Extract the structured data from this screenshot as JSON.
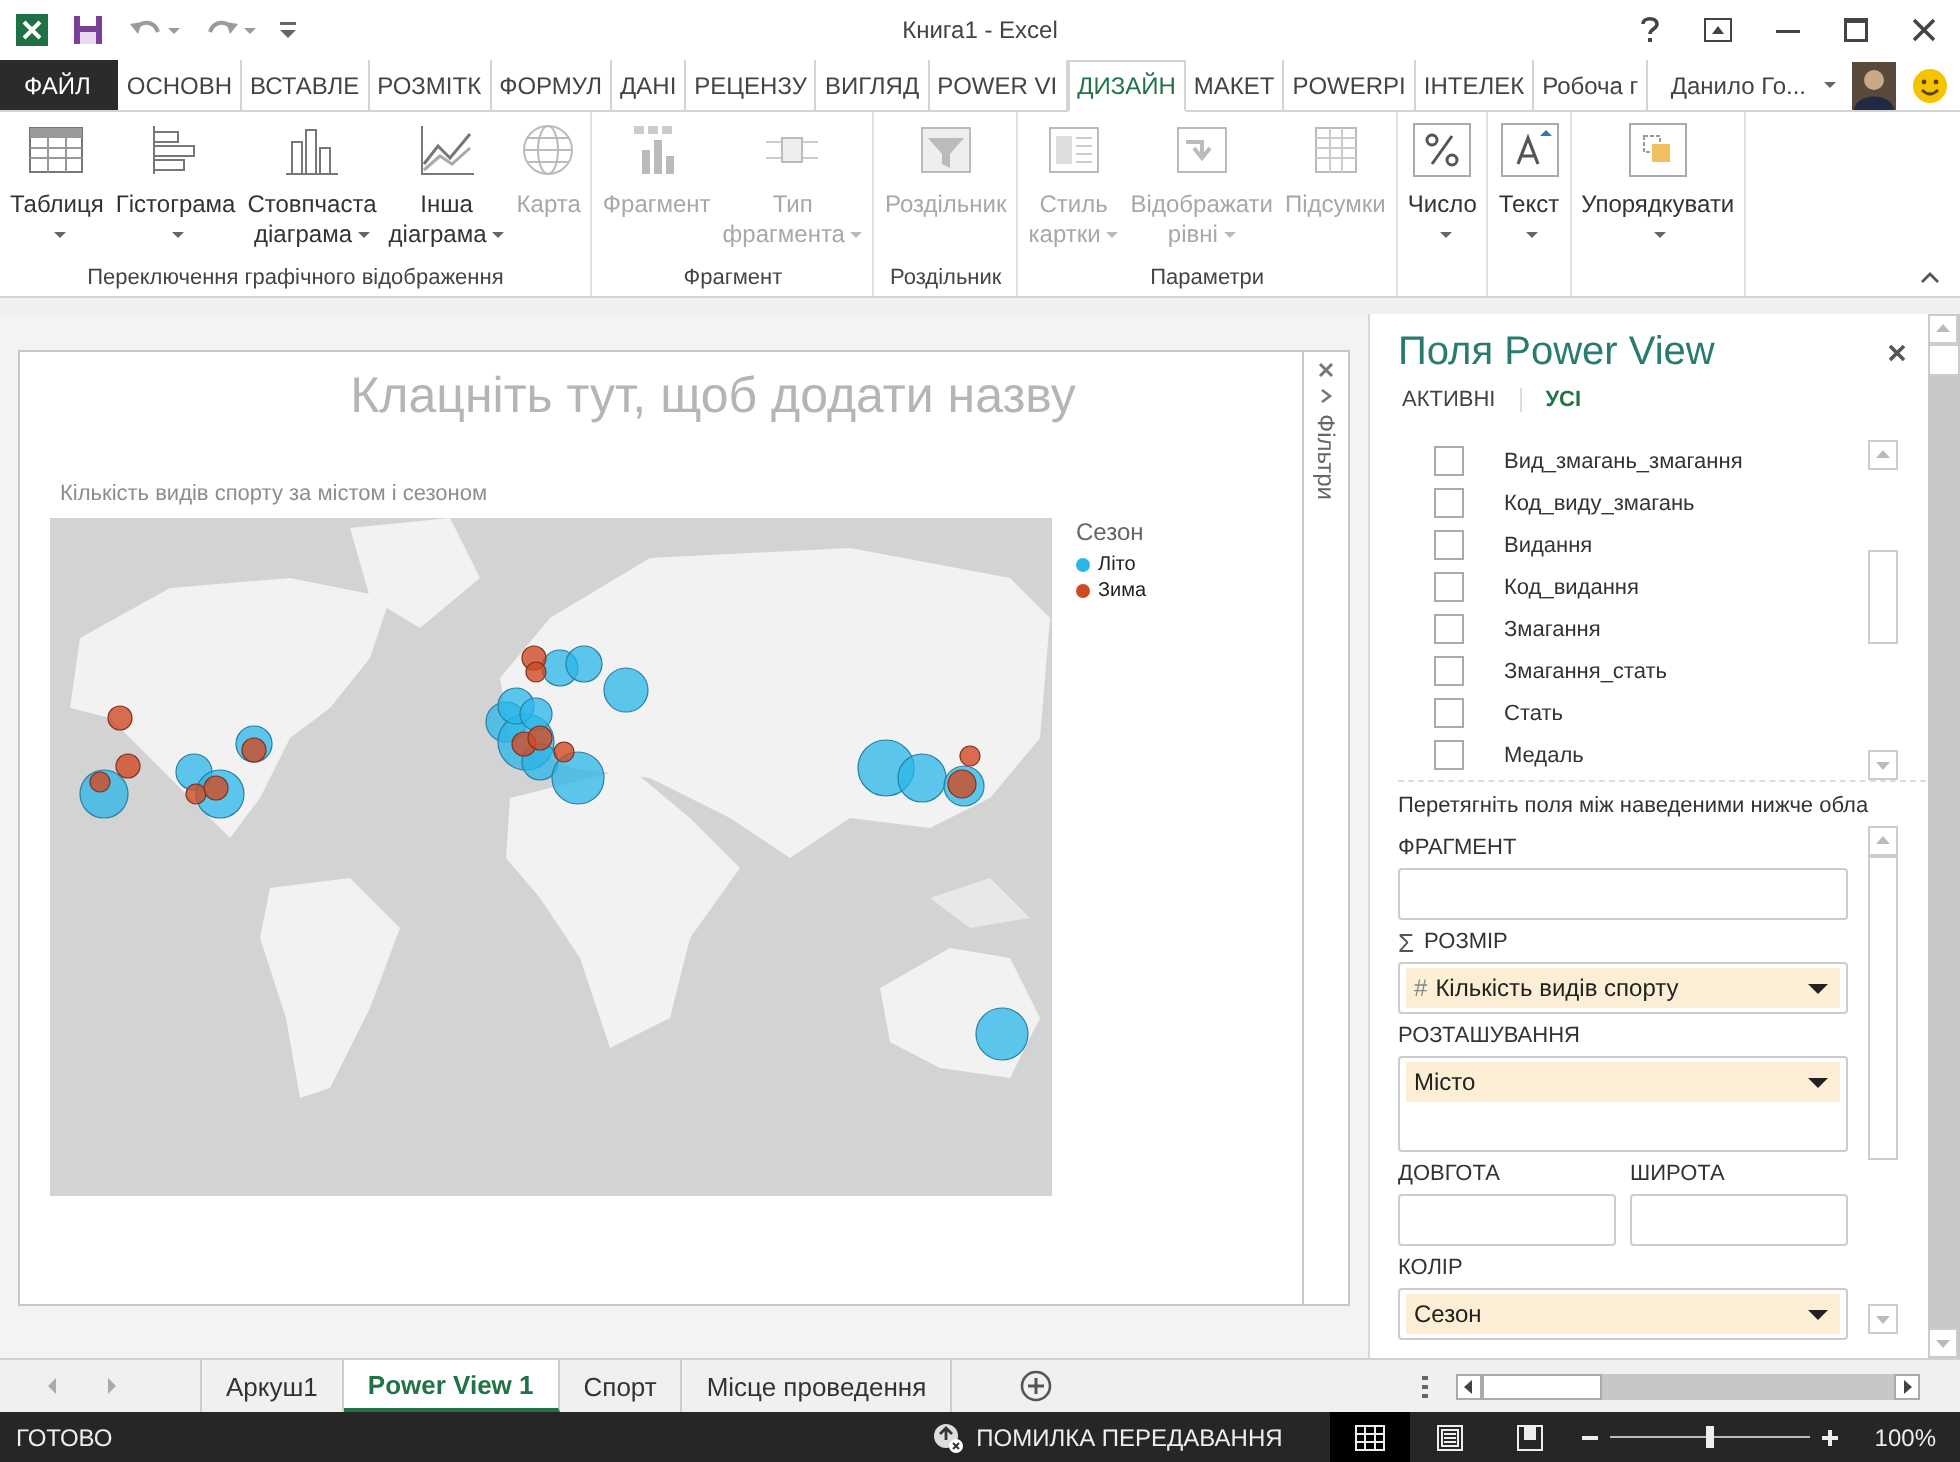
{
  "window": {
    "title": "Книга1 - Excel"
  },
  "menu_tabs": [
    {
      "label": "ФАЙЛ",
      "kind": "file",
      "selected": false
    },
    {
      "label": "ОСНОВН",
      "kind": "tab",
      "selected": false
    },
    {
      "label": "ВСТАВЛЕ",
      "kind": "tab",
      "selected": false
    },
    {
      "label": "РОЗМІТК",
      "kind": "tab",
      "selected": false
    },
    {
      "label": "ФОРМУЛ",
      "kind": "tab",
      "selected": false
    },
    {
      "label": "ДАНІ",
      "kind": "tab",
      "selected": false
    },
    {
      "label": "РЕЦЕНЗУ",
      "kind": "tab",
      "selected": false
    },
    {
      "label": "ВИГЛЯД",
      "kind": "tab",
      "selected": false
    },
    {
      "label": "POWER VI",
      "kind": "tab",
      "selected": false
    },
    {
      "label": "ДИЗАЙН",
      "kind": "tab",
      "selected": true
    },
    {
      "label": "МАКЕТ",
      "kind": "tab",
      "selected": false
    },
    {
      "label": "POWERPI",
      "kind": "tab",
      "selected": false
    },
    {
      "label": "ІНТЕЛЕК",
      "kind": "tab",
      "selected": false
    },
    {
      "label": "Робоча г",
      "kind": "tab",
      "selected": false
    }
  ],
  "user": {
    "name": "Данило Го..."
  },
  "ribbon": {
    "groups": [
      {
        "label": "Переключення графічного відображення",
        "buttons": [
          {
            "lines": [
              "Таблиця"
            ],
            "dropdown": true,
            "disabled": false
          },
          {
            "lines": [
              "Гістограма"
            ],
            "dropdown": true,
            "disabled": false
          },
          {
            "lines": [
              "Стовпчаста",
              "діаграма"
            ],
            "dropdown": true,
            "disabled": false
          },
          {
            "lines": [
              "Інша",
              "діаграма"
            ],
            "dropdown": true,
            "disabled": false
          },
          {
            "lines": [
              "Карта"
            ],
            "dropdown": false,
            "disabled": true
          }
        ]
      },
      {
        "label": "Фрагмент",
        "buttons": [
          {
            "lines": [
              "Фрагмент"
            ],
            "dropdown": false,
            "disabled": true
          },
          {
            "lines": [
              "Тип",
              "фрагмента"
            ],
            "dropdown": true,
            "disabled": true
          }
        ]
      },
      {
        "label": "Роздільник",
        "buttons": [
          {
            "lines": [
              "Роздільник"
            ],
            "dropdown": false,
            "disabled": true
          }
        ]
      },
      {
        "label": "Параметри",
        "buttons": [
          {
            "lines": [
              "Стиль",
              "картки"
            ],
            "dropdown": true,
            "disabled": true
          },
          {
            "lines": [
              "Відображати",
              "рівні"
            ],
            "dropdown": true,
            "disabled": true
          },
          {
            "lines": [
              "Підсумки"
            ],
            "dropdown": false,
            "disabled": true
          }
        ]
      },
      {
        "buttons": [
          {
            "lines": [
              "Число"
            ],
            "dropdown": true,
            "disabled": false
          }
        ]
      },
      {
        "buttons": [
          {
            "lines": [
              "Текст"
            ],
            "dropdown": true,
            "disabled": false
          }
        ]
      },
      {
        "buttons": [
          {
            "lines": [
              "Упорядкувати"
            ],
            "dropdown": true,
            "disabled": false
          }
        ]
      }
    ]
  },
  "canvas": {
    "title_placeholder": "Клацніть тут, щоб додати назву",
    "filters_label": "Фільтри",
    "chart": {
      "title": "Кількість видів спорту за містом і сезоном",
      "legend": {
        "title": "Сезон",
        "items": [
          {
            "label": "Літо",
            "color": "#29b6e8"
          },
          {
            "label": "Зима",
            "color": "#cf4a24"
          }
        ]
      }
    }
  },
  "fields_pane": {
    "title": "Поля Power View",
    "tabs": [
      {
        "label": "АКТИВНІ",
        "selected": false
      },
      {
        "label": "УСІ",
        "selected": true
      }
    ],
    "fields": [
      {
        "label": "Вид_змагань_змагання",
        "checked": false
      },
      {
        "label": "Код_виду_змагань",
        "checked": false
      },
      {
        "label": "Видання",
        "checked": false
      },
      {
        "label": "Код_видання",
        "checked": false
      },
      {
        "label": "Змагання",
        "checked": false
      },
      {
        "label": "Змагання_стать",
        "checked": false
      },
      {
        "label": "Стать",
        "checked": false
      },
      {
        "label": "Медаль",
        "checked": false
      }
    ],
    "hint": "Перетягніть поля між наведеними нижче обла",
    "zones": [
      {
        "kind": "single",
        "label": "ФРАГМЕНТ"
      },
      {
        "kind": "single",
        "label": "РОЗМІР",
        "symbol": "Σ",
        "item": {
          "symbol": "#",
          "label": "Кількість видів спорту"
        }
      },
      {
        "kind": "multi",
        "label": "РОЗТАШУВАННЯ",
        "item": {
          "label": "Місто"
        }
      },
      {
        "kind": "half",
        "label": "ДОВГОТА"
      },
      {
        "kind": "half",
        "label": "ШИРОТА"
      },
      {
        "kind": "single",
        "label": "КОЛІР",
        "item": {
          "label": "Сезон"
        }
      }
    ]
  },
  "sheets": [
    {
      "label": "Аркуш1",
      "selected": false
    },
    {
      "label": "Power View 1",
      "selected": true
    },
    {
      "label": "Спорт",
      "selected": false
    },
    {
      "label": "Місце проведення",
      "selected": false
    }
  ],
  "status": {
    "text": "ГОТОВО",
    "error": "ПОМИЛКА ПЕРЕДАВАННЯ",
    "views": [
      {
        "kind": "normal",
        "selected": true
      },
      {
        "kind": "layout",
        "selected": false
      },
      {
        "kind": "page",
        "selected": false
      }
    ],
    "zoom": {
      "level": 0.5,
      "reading": "100%"
    }
  }
}
